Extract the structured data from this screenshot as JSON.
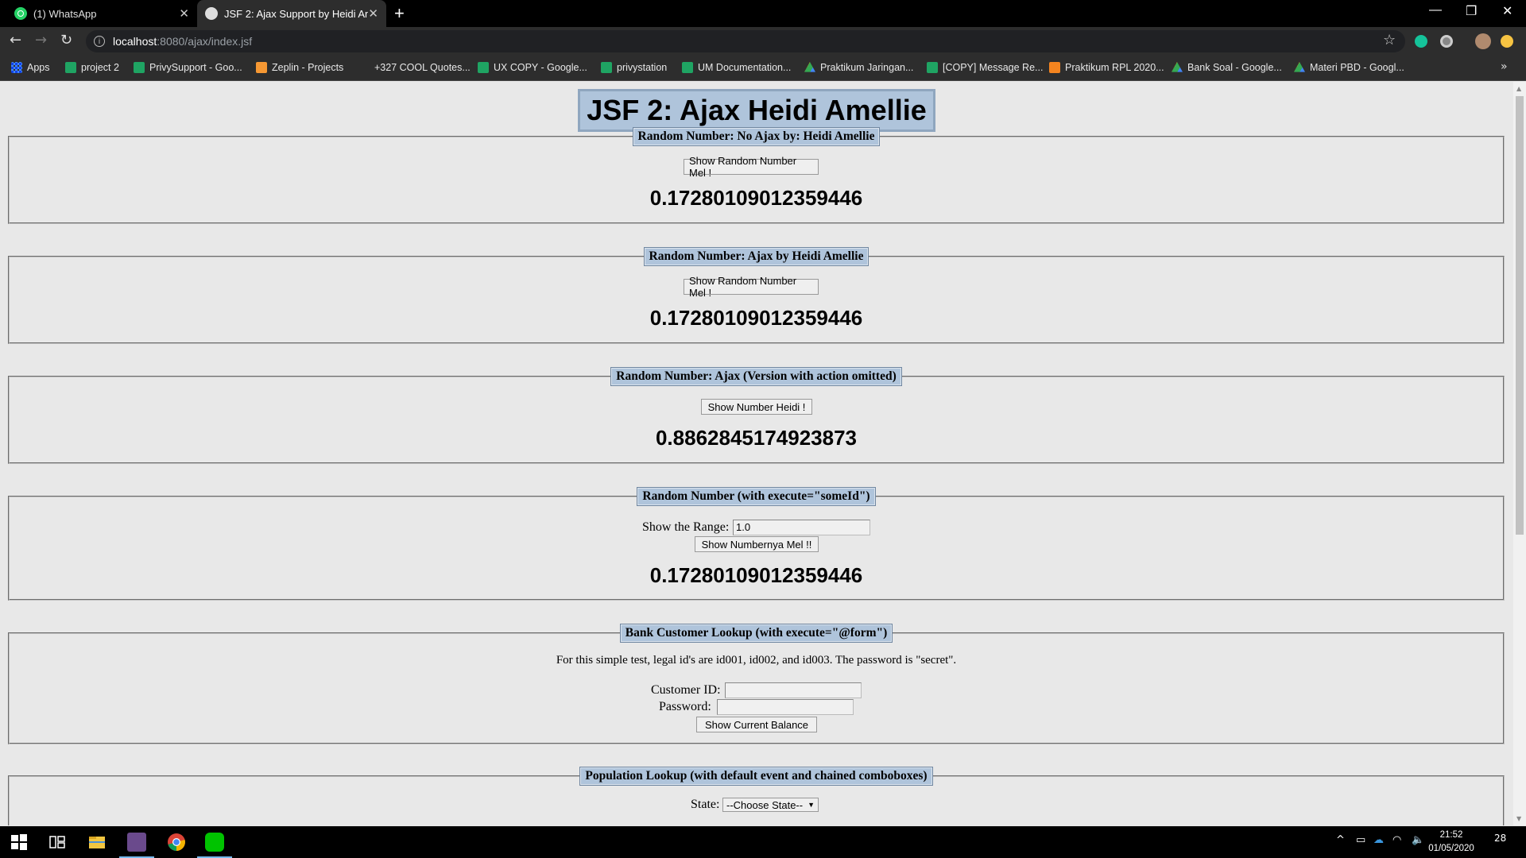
{
  "browser": {
    "tabs": [
      {
        "title": "(1) WhatsApp",
        "icon": "whatsapp-icon"
      },
      {
        "title": "JSF 2: Ajax Support by Heidi Amellie",
        "icon": "globe-icon",
        "active": true
      }
    ],
    "url_host": "localhost",
    "url_path": ":8080/ajax/index.jsf",
    "bookmarks": [
      {
        "label": "Apps",
        "icon": "apps-icon"
      },
      {
        "label": "project 2",
        "icon": "sheets-icon"
      },
      {
        "label": "PrivySupport - Goo...",
        "icon": "sheets-icon"
      },
      {
        "label": "Zeplin - Projects",
        "icon": "zeplin-icon"
      },
      {
        "label": "+327 COOL Quotes...",
        "icon": "none"
      },
      {
        "label": "UX COPY - Google...",
        "icon": "sheets-icon"
      },
      {
        "label": "privystation",
        "icon": "sheets-icon"
      },
      {
        "label": "UM Documentation...",
        "icon": "sheets-icon"
      },
      {
        "label": "Praktikum Jaringan...",
        "icon": "drive-icon"
      },
      {
        "label": "[COPY] Message Re...",
        "icon": "sheets-icon"
      },
      {
        "label": "Praktikum RPL 2020...",
        "icon": "slides-icon"
      },
      {
        "label": "Bank Soal - Google...",
        "icon": "drive-icon"
      },
      {
        "label": "Materi PBD - Googl...",
        "icon": "drive-icon"
      }
    ]
  },
  "page": {
    "title": "JSF 2: Ajax Heidi Amellie",
    "sections": [
      {
        "legend": "Random Number: No Ajax by: Heidi Amellie",
        "button": "Show Random Number Mel !",
        "result": "0.17280109012359446"
      },
      {
        "legend": "Random Number: Ajax by Heidi Amellie",
        "button": "Show Random Number Mel !",
        "result": "0.17280109012359446"
      },
      {
        "legend": "Random Number: Ajax (Version with action omitted)",
        "button": "Show Number Heidi !",
        "result": "0.8862845174923873"
      },
      {
        "legend": "Random Number (with execute=\"someId\")",
        "range_label": "Show the Range:",
        "range_value": "1.0",
        "button": "Show Numbernya Mel !!",
        "result": "0.17280109012359446"
      },
      {
        "legend": "Bank Customer Lookup (with execute=\"@form\")",
        "note": "For this simple test, legal id's are id001, id002, and id003. The password is \"secret\".",
        "customer_id_label": "Customer ID:",
        "customer_id_value": "",
        "password_label": "Password:",
        "password_value": "",
        "button": "Show Current Balance"
      },
      {
        "legend": "Population Lookup (with default event and chained comboboxes)",
        "state_label": "State:",
        "state_selected": "--Choose State--"
      }
    ]
  },
  "taskbar": {
    "time": "21:52",
    "date": "01/05/2020",
    "notifications": "28"
  }
}
